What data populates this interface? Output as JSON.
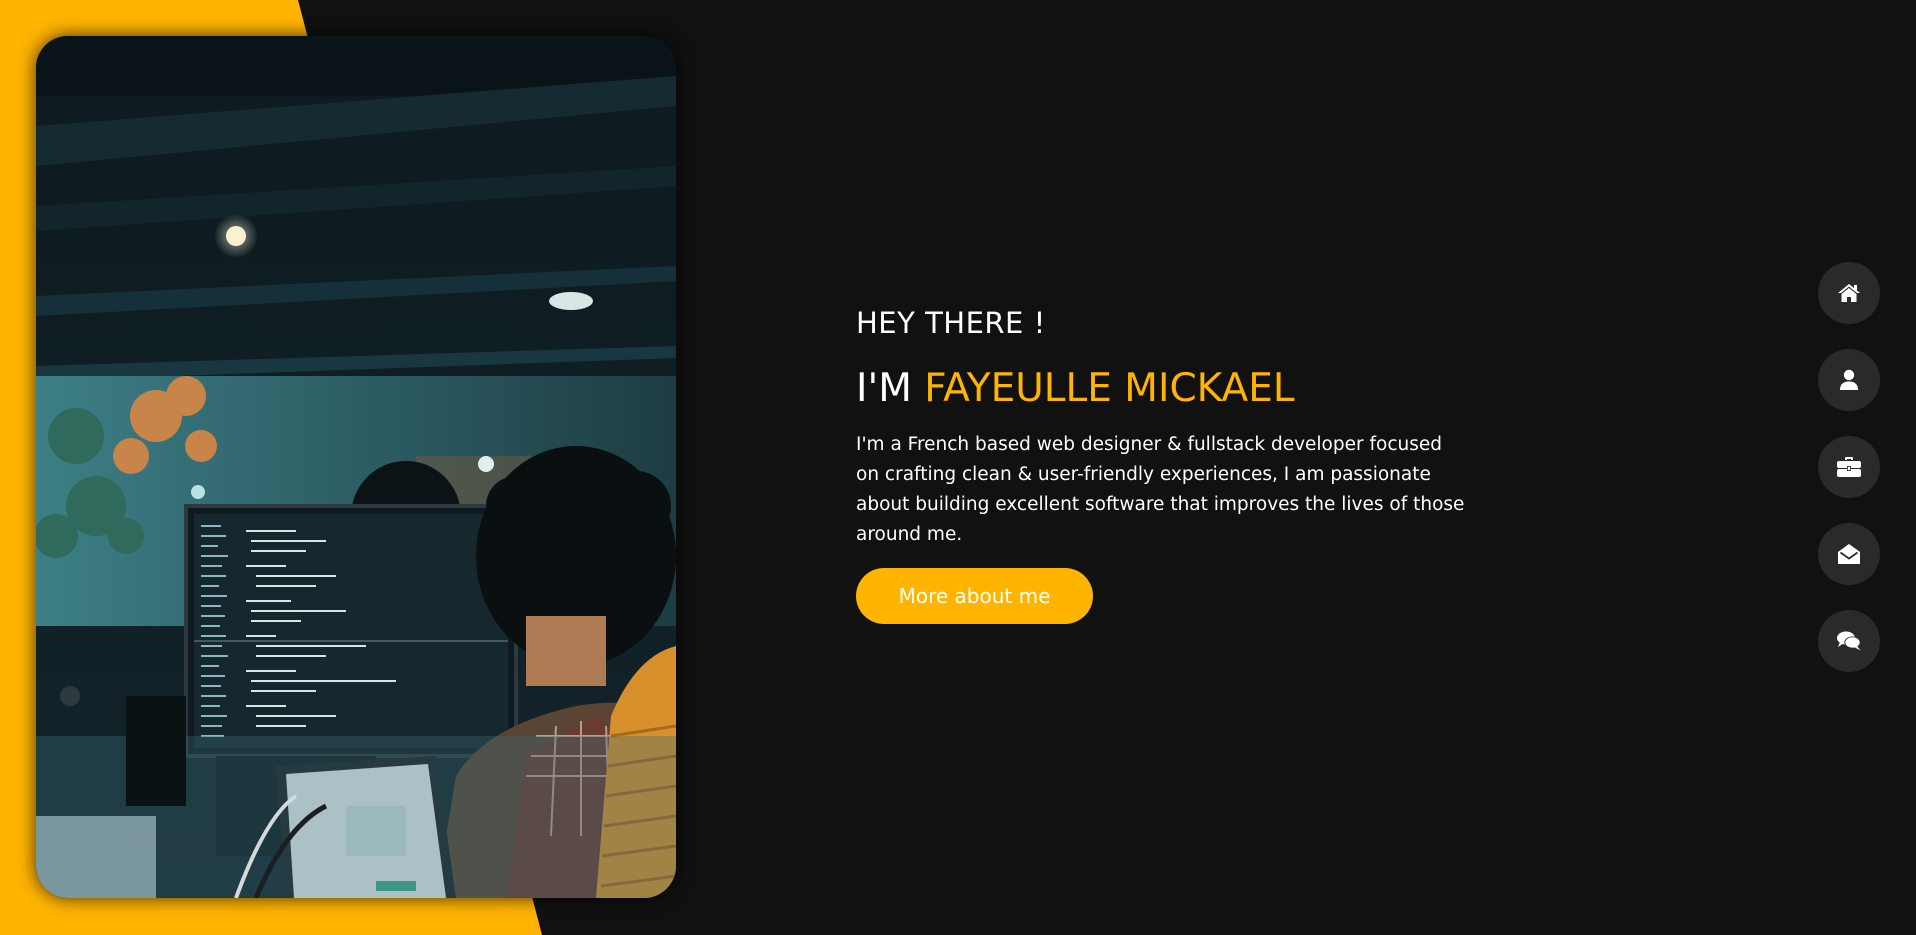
{
  "theme": {
    "accent": "#ffb400",
    "background": "#111111",
    "nav_button_bg": "#2b2a2a",
    "text": "#ffffff"
  },
  "hero": {
    "greeting": "HEY THERE !",
    "name_prefix": "I'M ",
    "name": "FAYEULLE MICKAEL",
    "bio": "I'm a French based web designer & fullstack developer focused on crafting clean & user-friendly experiences, I am passionate about building excellent software that improves the lives of those around me.",
    "cta_label": "More about me"
  },
  "photo": {
    "icon": "developer-at-desk-photo"
  },
  "side_nav": [
    {
      "icon": "home-icon"
    },
    {
      "icon": "user-icon"
    },
    {
      "icon": "briefcase-icon"
    },
    {
      "icon": "envelope-open-icon"
    },
    {
      "icon": "comments-icon"
    }
  ]
}
